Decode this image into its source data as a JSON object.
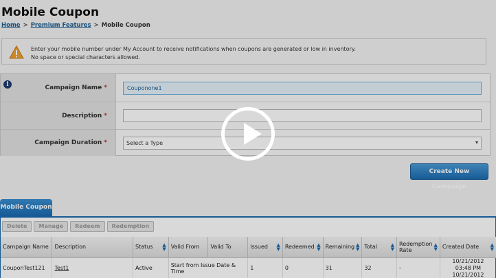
{
  "page": {
    "title": "Mobile Coupon"
  },
  "breadcrumb": {
    "home": "Home",
    "sep1": ">",
    "premium": "Premium Features",
    "sep2": ">",
    "current": "Mobile Coupon"
  },
  "alert": {
    "line1": "Enter your mobile number under My Account to receive notifications when coupons are generated or low in inventory.",
    "line2": "No space or special characters allowed."
  },
  "form": {
    "campaign_name_label": "Campaign Name",
    "campaign_name_value": "Couponone1",
    "description_label": "Description",
    "description_value": "",
    "duration_label": "Campaign Duration",
    "duration_value": "Select a Type",
    "required_mark": "*"
  },
  "create_button": "Create New Campaign",
  "tab": {
    "label": "Mobile Coupon"
  },
  "toolbar": {
    "delete": "Delete",
    "manage": "Manage",
    "redeem": "Redeem",
    "redemption": "Redemption"
  },
  "table": {
    "headers": [
      "Campaign Name",
      "Description",
      "Status",
      "Valid From",
      "Valid To",
      "Issued",
      "Redeemed",
      "Remaining",
      "Total",
      "Redemption Rate",
      "Created Date"
    ],
    "rows": [
      {
        "campaign": "CouponTest121",
        "description": "Test1",
        "status": "Active",
        "valid_from": "Start from Issue Date & Time",
        "issued": "1",
        "redeemed": "0",
        "remaining": "31",
        "total": "32",
        "rate": "-",
        "created_date": "10/21/2012",
        "created_time": "03:48 PM",
        "created_next": "10/21/2012"
      }
    ]
  },
  "colors": {
    "accent": "#1a6ab0",
    "required": "#c0392b",
    "warning": "#f0a030"
  },
  "icons": {
    "warning": "warning-icon",
    "info": "info-icon",
    "play": "play-icon",
    "sort": "sort-icon",
    "dropdown": "chevron-down-icon"
  }
}
